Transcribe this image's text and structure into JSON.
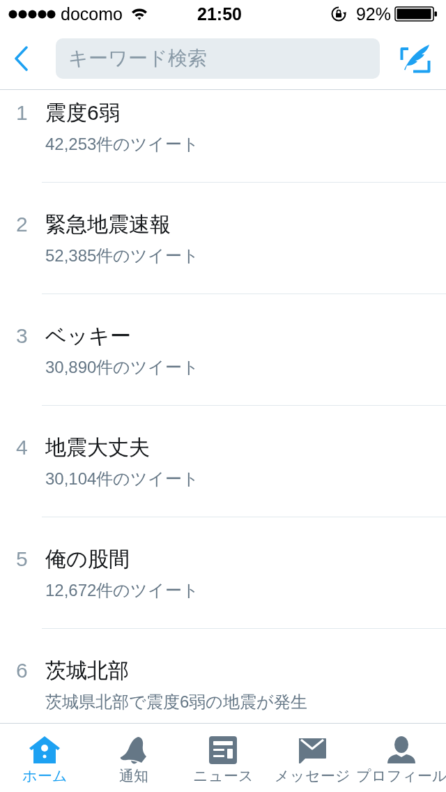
{
  "status_bar": {
    "carrier": "docomo",
    "time": "21:50",
    "battery": "92%"
  },
  "header": {
    "search": {
      "placeholder": "キーワード検索"
    }
  },
  "trends": [
    {
      "rank": "1",
      "title": "震度6弱",
      "subtitle": "42,253件のツイート"
    },
    {
      "rank": "2",
      "title": "緊急地震速報",
      "subtitle": "52,385件のツイート"
    },
    {
      "rank": "3",
      "title": "ベッキー",
      "subtitle": "30,890件のツイート"
    },
    {
      "rank": "4",
      "title": "地震大丈夫",
      "subtitle": "30,104件のツイート"
    },
    {
      "rank": "5",
      "title": "俺の股間",
      "subtitle": "12,672件のツイート"
    },
    {
      "rank": "6",
      "title": "茨城北部",
      "subtitle": "茨城県北部で震度6弱の地震が発生"
    }
  ],
  "tab_bar": [
    {
      "kind": "home",
      "label": "ホーム",
      "selected": true
    },
    {
      "kind": "notifications",
      "label": "通知",
      "selected": false
    },
    {
      "kind": "news",
      "label": "ニュース",
      "selected": false
    },
    {
      "kind": "messages",
      "label": "メッセージ",
      "selected": false
    },
    {
      "kind": "profile",
      "label": "プロフィール",
      "selected": false
    }
  ]
}
